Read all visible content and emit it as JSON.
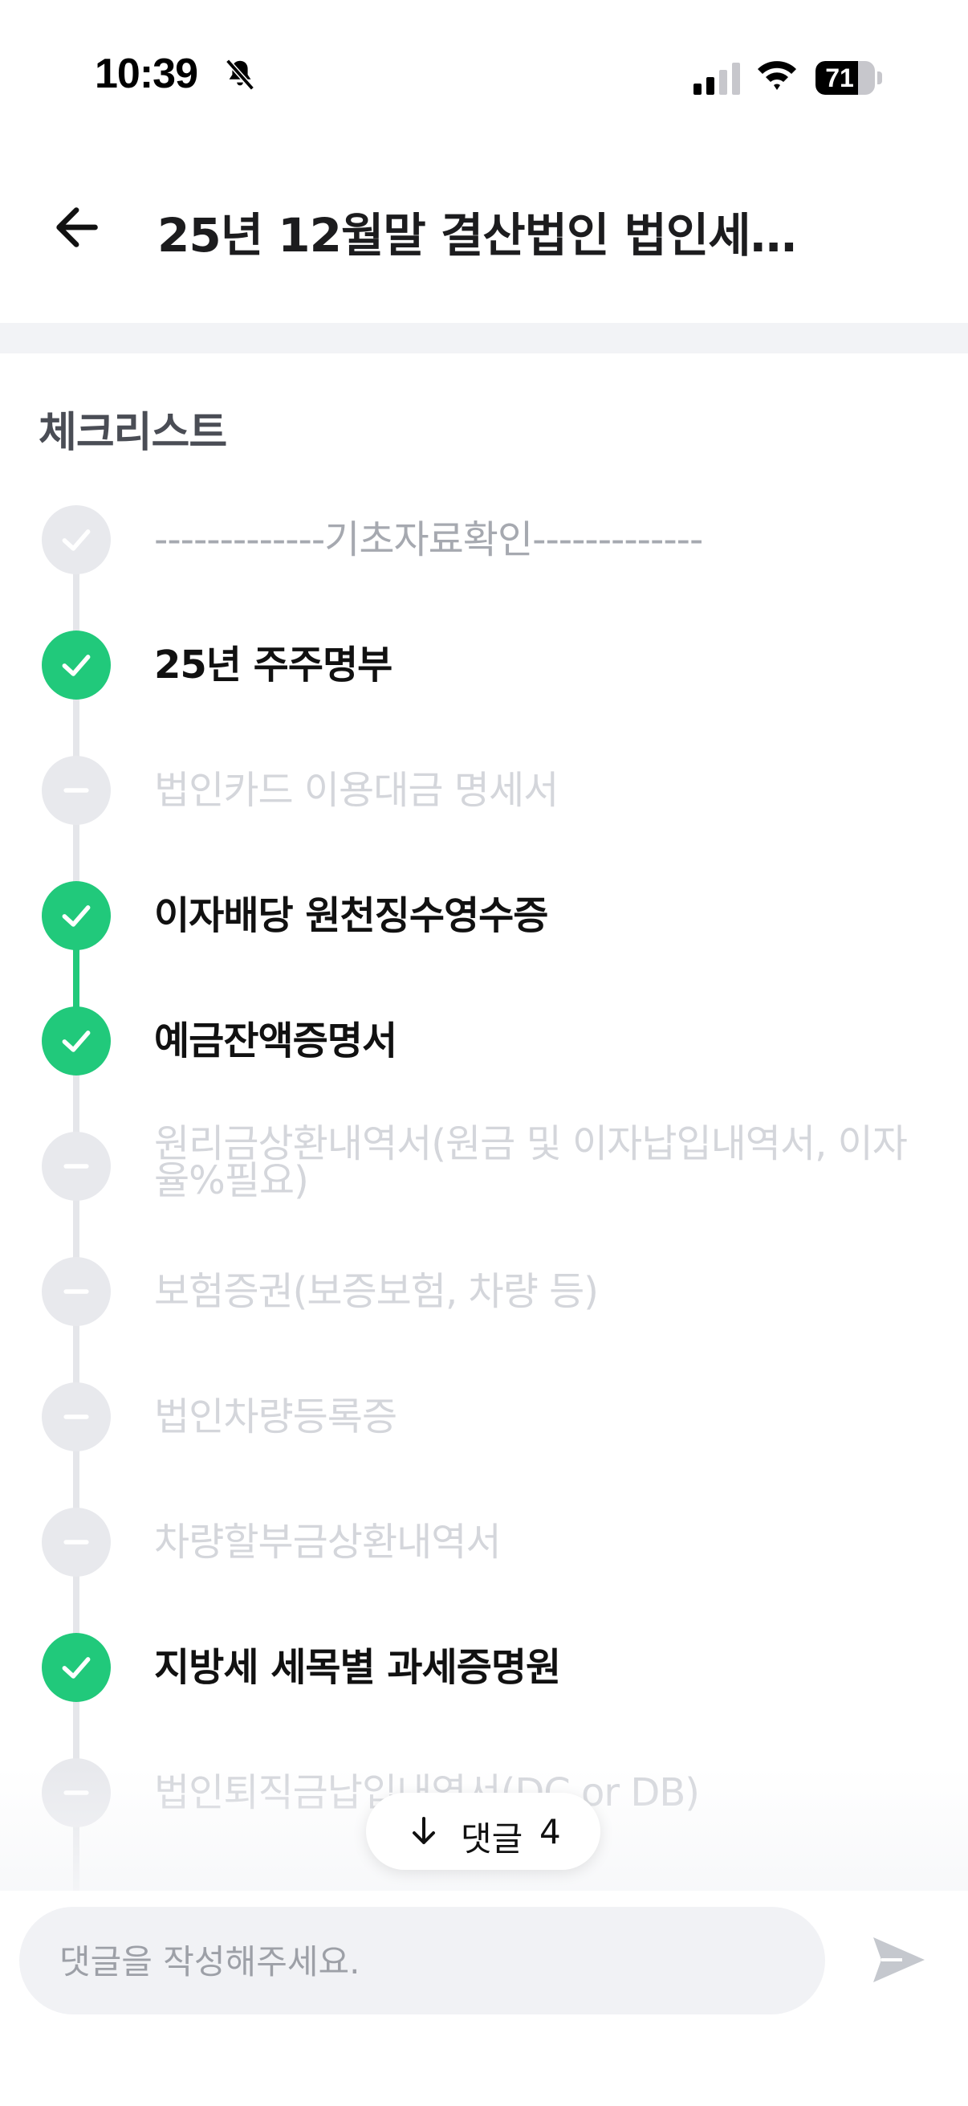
{
  "status_bar": {
    "time": "10:39",
    "battery": "71",
    "battery_level": 0.71
  },
  "header": {
    "title": "25년 12월말 결산법인 법인세 ..."
  },
  "section_title": "체크리스트",
  "checklist": [
    {
      "label": "-------------기초자료확인-------------",
      "status": "header"
    },
    {
      "label": "25년 주주명부",
      "status": "done"
    },
    {
      "label": "법인카드 이용대금 명세서",
      "status": "pending"
    },
    {
      "label": "이자배당 원천징수영수증",
      "status": "done"
    },
    {
      "label": "예금잔액증명서",
      "status": "done"
    },
    {
      "label": "원리금상환내역서(원금 및 이자납입내역서, 이자율%필요)",
      "status": "pending"
    },
    {
      "label": "보험증권(보증보험, 차량 등)",
      "status": "pending"
    },
    {
      "label": "법인차량등록증",
      "status": "pending"
    },
    {
      "label": "차량할부금상환내역서",
      "status": "pending"
    },
    {
      "label": "지방세 세목별 과세증명원",
      "status": "done"
    },
    {
      "label": "법인퇴직금납입내역서(DC or DB)",
      "status": "pending"
    }
  ],
  "comments_button": {
    "label": "댓글",
    "count": "4"
  },
  "comment_input": {
    "placeholder": "댓글을 작성해주세요."
  },
  "colors": {
    "done": "#21c97b",
    "pending": "#e8e9ed",
    "line": "#e5e6ea"
  },
  "icons": {
    "back": "arrow-left-icon",
    "send": "send-icon",
    "comments": "arrow-down-icon",
    "mute": "bell-slash-icon"
  }
}
